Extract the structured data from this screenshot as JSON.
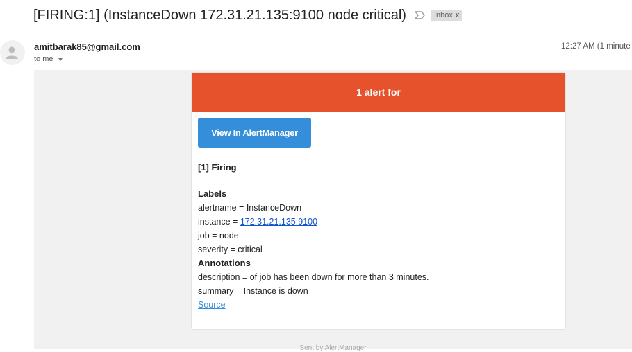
{
  "email": {
    "subject": "[FIRING:1] (InstanceDown 172.31.21.135:9100 node critical)",
    "label_chip": "Inbox",
    "label_chip_close": "x",
    "sender": "amitbarak85@gmail.com",
    "recipient_line": "to me",
    "timestamp": "12:27 AM (1 minute"
  },
  "alert": {
    "header": "1 alert for",
    "button_label": "View In AlertManager",
    "firing_title": "[1] Firing",
    "labels_title": "Labels",
    "labels": {
      "alertname": "alertname = InstanceDown",
      "instance_prefix": "instance = ",
      "instance_link": "172.31.21.135:9100",
      "job": "job = node",
      "severity": "severity = critical"
    },
    "annotations_title": "Annotations",
    "annotations": {
      "description": "description = of job has been down for more than 3 minutes.",
      "summary": "summary = Instance is down"
    },
    "source_link": "Source",
    "footer": "Sent by AlertManager"
  },
  "colors": {
    "header_bg": "#e6522c",
    "button_bg": "#348eda",
    "body_bg": "#f1f1f1"
  }
}
